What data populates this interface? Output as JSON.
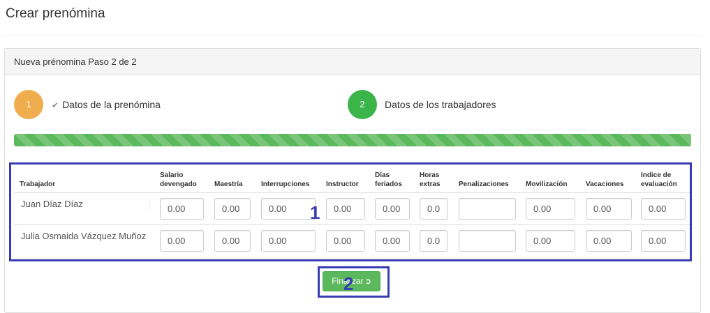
{
  "page": {
    "title": "Crear prenómina"
  },
  "panel": {
    "heading": "Nueva prénomina Paso 2 de 2"
  },
  "steps": [
    {
      "number": "1",
      "label": "Datos de la prenómina",
      "status": "done"
    },
    {
      "number": "2",
      "label": "Datos de los trabajadores",
      "status": "active"
    }
  ],
  "progress": {
    "value": 1.0
  },
  "table": {
    "headers": [
      [
        "Trabajador"
      ],
      [
        "Salario",
        "devengado"
      ],
      [
        "Maestría"
      ],
      [
        "Interrupciones"
      ],
      [
        "Instructor"
      ],
      [
        "Días",
        "feriados"
      ],
      [
        "Horas",
        "extras"
      ],
      [
        "Penalizaciones"
      ],
      [
        "Movilización"
      ],
      [
        "Vacaciones"
      ],
      [
        "Indice de",
        "evaluación"
      ]
    ],
    "rows": [
      {
        "worker": "Juan Díaz Díaz",
        "values": [
          "0.00",
          "0.00",
          "0.00",
          "0.00",
          "0.00",
          "0.0",
          "",
          "0.00",
          "0.00",
          "0.00"
        ]
      },
      {
        "worker": "Julia Osmaida Vázquez Muñoz",
        "values": [
          "0.00",
          "0.00",
          "0.00",
          "0.00",
          "0.00",
          "0.0",
          "",
          "0.00",
          "0.00",
          "0.00"
        ]
      }
    ]
  },
  "annotations": {
    "box1": "1",
    "box2": "2"
  },
  "finish_button": {
    "label": "Finalizar",
    "icon": "arrow-circle-right-icon"
  },
  "colors": {
    "step_done": "#f0ad4e",
    "step_active": "#3bb54a",
    "progress": "#5cb85c",
    "annotation": "#3a3cb3",
    "button": "#5cb85c"
  }
}
